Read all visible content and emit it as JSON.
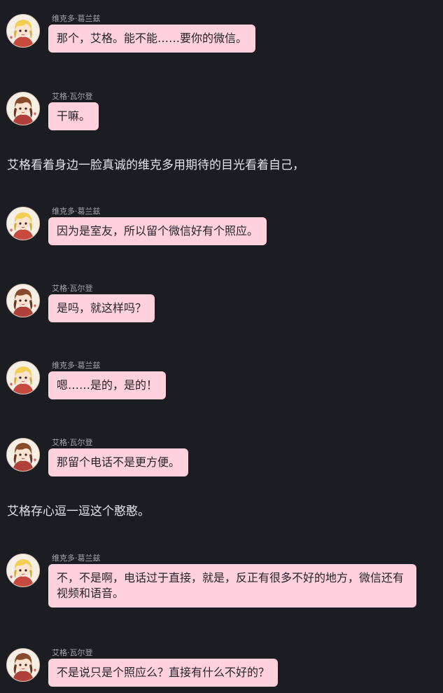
{
  "chat": {
    "items": [
      {
        "type": "message",
        "speaker": "viktor",
        "name": "维克多·葛兰兹",
        "text": "那个，艾格。能不能……要你的微信。"
      },
      {
        "type": "message",
        "speaker": "ega",
        "name": "艾格·瓦尔登",
        "text": "干嘛。"
      },
      {
        "type": "narration",
        "text": "艾格看着身边一脸真诚的维克多用期待的目光看着自己，"
      },
      {
        "type": "message",
        "speaker": "viktor",
        "name": "维克多·葛兰兹",
        "text": "因为是室友，所以留个微信好有个照应。"
      },
      {
        "type": "message",
        "speaker": "ega",
        "name": "艾格·瓦尔登",
        "text": "是吗，就这样吗？"
      },
      {
        "type": "message",
        "speaker": "viktor",
        "name": "维克多·葛兰兹",
        "text": "嗯……是的，是的！"
      },
      {
        "type": "message",
        "speaker": "ega",
        "name": "艾格·瓦尔登",
        "text": "那留个电话不是更方便。"
      },
      {
        "type": "narration",
        "text": "艾格存心逗一逗这个憨憨。"
      },
      {
        "type": "message",
        "speaker": "viktor",
        "name": "维克多·葛兰兹",
        "text": "不，不是啊，电话过于直接，就是，反正有很多不好的地方，微信还有视频和语音。"
      },
      {
        "type": "message",
        "speaker": "ega",
        "name": "艾格·瓦尔登",
        "text": "不是说只是个照应么？直接有什么不好的？"
      }
    ]
  },
  "avatars": {
    "viktor": {
      "icon": "blond-character-avatar-icon",
      "hair": "#f2cf52",
      "hair_shadow": "#d9a93a",
      "outfit": "#c64a3e"
    },
    "ega": {
      "icon": "brunette-character-avatar-icon",
      "hair": "#8a4b2c",
      "hair_shadow": "#6b3620",
      "outfit": "#b0403a"
    }
  },
  "colors": {
    "background": "#1c1d23",
    "bubble": "#ffd1dc",
    "bubble_text": "#24242a",
    "sender_text": "#a7a8ae",
    "narration_text": "#e4e4e8"
  }
}
